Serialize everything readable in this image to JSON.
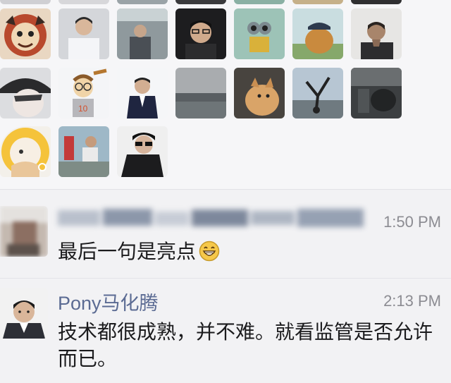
{
  "likes": {
    "avatars": [
      {
        "name": "avatar-monkey-art"
      },
      {
        "name": "avatar-man-white-shirt"
      },
      {
        "name": "avatar-man-office"
      },
      {
        "name": "avatar-man-glasses-dark"
      },
      {
        "name": "avatar-robot-toy"
      },
      {
        "name": "avatar-dog-cap"
      },
      {
        "name": "avatar-man-hand-chin"
      },
      {
        "name": "avatar-anime-hat"
      },
      {
        "name": "avatar-cartoon-baseball"
      },
      {
        "name": "avatar-man-suit"
      },
      {
        "name": "avatar-landscape"
      },
      {
        "name": "avatar-dog-fluffy"
      },
      {
        "name": "avatar-breakdance"
      },
      {
        "name": "avatar-dark-scene"
      },
      {
        "name": "avatar-baby"
      },
      {
        "name": "avatar-man-squatting"
      },
      {
        "name": "avatar-man-sunglasses"
      }
    ]
  },
  "comments": [
    {
      "name": "",
      "time": "1:50 PM",
      "text": "最后一句是亮点",
      "emoji": "grin-emoji"
    },
    {
      "name": "Pony马化腾",
      "time": "2:13 PM",
      "text": "技术都很成熟，并不难。就看监管是否允许而已。"
    }
  ],
  "colors": {
    "name_link": "#5b6b93",
    "time": "#8c8c92",
    "text": "#1b1b1d"
  }
}
